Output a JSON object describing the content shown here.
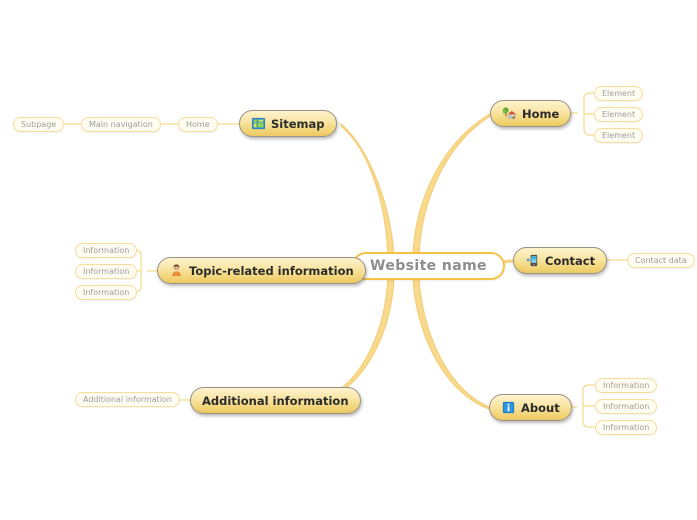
{
  "diagram": {
    "type": "mind-map",
    "title": "Website name",
    "palette": {
      "branch_fill_top": "#fdf3cd",
      "branch_fill_bottom": "#edc961",
      "branch_border": "#9a9186",
      "root_border": "#f5c243",
      "root_text": "#8d8d8d",
      "leaf_fill": "#fffdf2",
      "leaf_border": "#f6dd9b",
      "leaf_text": "#9d9d9d",
      "edge": "#f7d98a"
    }
  },
  "root": {
    "label": "Website name"
  },
  "branches": [
    {
      "id": "sitemap",
      "label": "Sitemap",
      "icon": "sitemap-icon",
      "children": [
        {
          "label": "Home"
        },
        {
          "label": "Main navigation"
        },
        {
          "label": "Subpage"
        }
      ]
    },
    {
      "id": "home",
      "label": "Home",
      "icon": "house-tree-icon",
      "children": [
        {
          "label": "Element"
        },
        {
          "label": "Element"
        },
        {
          "label": "Element"
        }
      ]
    },
    {
      "id": "contact",
      "label": "Contact",
      "icon": "mobile-phone-icon",
      "children": [
        {
          "label": "Contact data"
        }
      ]
    },
    {
      "id": "about",
      "label": "About",
      "icon": "info-icon",
      "children": [
        {
          "label": "Information"
        },
        {
          "label": "Information"
        },
        {
          "label": "Information"
        }
      ]
    },
    {
      "id": "topic-related-information",
      "label": "Topic-related information",
      "icon": "person-icon",
      "children": [
        {
          "label": "Information"
        },
        {
          "label": "Information"
        },
        {
          "label": "Information"
        }
      ]
    },
    {
      "id": "additional-information",
      "label": "Additional information",
      "icon": null,
      "children": [
        {
          "label": "Additional information"
        }
      ]
    }
  ]
}
